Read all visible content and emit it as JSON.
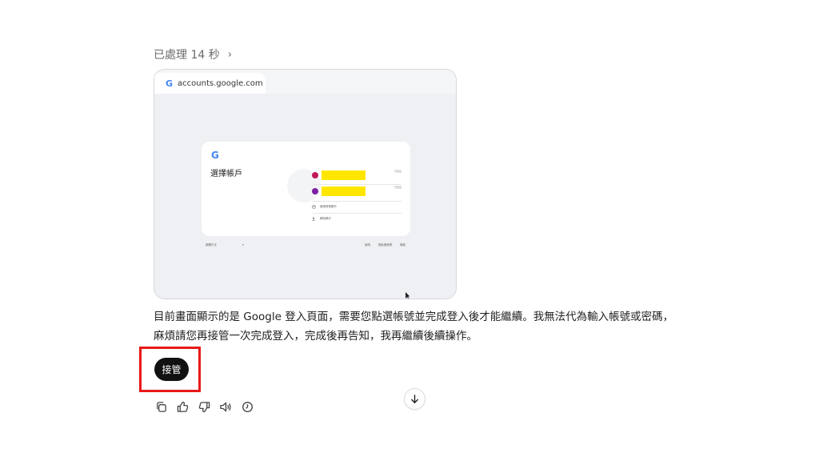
{
  "processed": {
    "label": "已處理 14 秒",
    "chevron": "›"
  },
  "screenshot": {
    "tab_url": "accounts.google.com",
    "logo": "G",
    "heading": "選擇帳戶",
    "accounts": [
      {
        "dot_color": "#c2185b",
        "tag": "已登出"
      },
      {
        "dot_color": "#7b1fa2",
        "tag": "已登出"
      }
    ],
    "rows": [
      {
        "icon": "account-circle-icon",
        "label": "使用其他帳戶"
      },
      {
        "icon": "remove-user-icon",
        "label": "移除帳戶"
      }
    ],
    "footer": {
      "language": "繁體中文",
      "language_caret": "▾",
      "links": [
        "說明",
        "隱私權政策",
        "條款"
      ]
    },
    "highlight_color": "#ffe600"
  },
  "message": {
    "line1": "目前畫面顯示的是 Google 登入頁面，需要您點選帳號並完成登入後才能繼續。我無法代為輸入帳號或密碼，",
    "line2": "麻煩請您再接管一次完成登入，完成後再告知，我再繼續後續操作。"
  },
  "takeover": {
    "label": "接管",
    "highlight_border": "#e81818"
  },
  "actions": [
    "copy-icon",
    "thumbs-up-icon",
    "thumbs-down-icon",
    "speaker-icon",
    "history-icon"
  ]
}
